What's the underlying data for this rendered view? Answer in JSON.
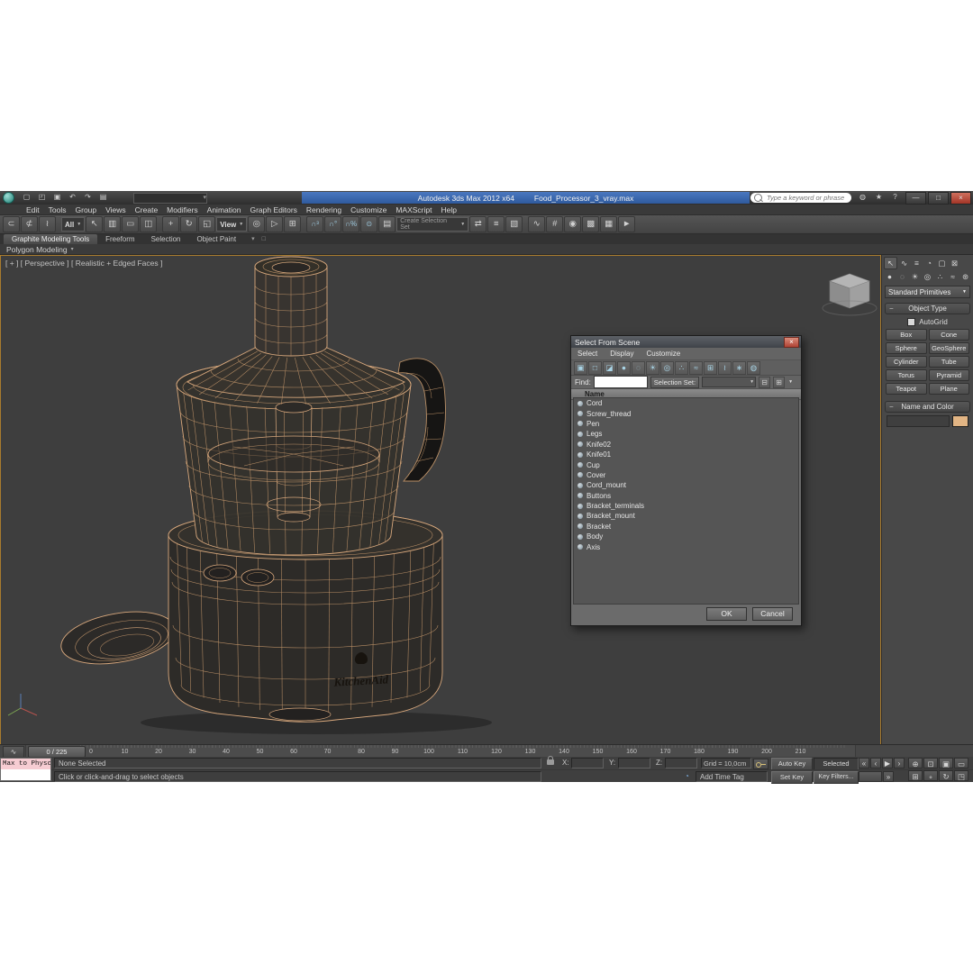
{
  "colors": {
    "wireframe": "#d8a87d",
    "wireframe_dim": "#b98f66",
    "viewport_border": "#a87b2e",
    "object_color": "#e2b584",
    "close_button": "#b04335",
    "title_strip": "#3f6db5"
  },
  "window": {
    "title_app": "Autodesk 3ds Max 2012 x64",
    "title_file": "Food_Processor_3_vray.max",
    "search_placeholder": "Type a keyword or phrase"
  },
  "icons": {
    "new": "▢",
    "open": "◰",
    "save": "▣",
    "undo": "↶",
    "redo": "↷",
    "project": "▤",
    "caret": "▼",
    "caret_small": "▾",
    "minimize": "—",
    "maximize": "□",
    "close": "×",
    "comm": "◍",
    "fav": "★",
    "help": "?",
    "link": "⊂",
    "unlink": "⊄",
    "bind": "≀",
    "sel": "↖",
    "byname": "▥",
    "region": "▭",
    "window": "◫",
    "move": "+",
    "rotate": "↻",
    "scale": "◱",
    "pivot": "◎",
    "manip": "▷",
    "kbd": "⊞",
    "snap": "∩³",
    "asnap": "∩°",
    "psnap": "∩%",
    "ssnap": "⊙",
    "sets": "▤",
    "mirror": "⇄",
    "align": "≡",
    "layers": "▧",
    "curve": "∿",
    "schem": "#",
    "mat": "◉",
    "rset": "▩",
    "rfw": "▦",
    "render": "►",
    "create": "↖",
    "modify": "∿",
    "hier": "≡",
    "motion": "◔",
    "display": "▢",
    "utils": "⊠",
    "geo": "●",
    "shapes": "◌",
    "lights": "☀",
    "cams": "◎",
    "helpers": "∴",
    "warps": "≈",
    "systems": "⊛",
    "collapse": "−",
    "dlg_tools": [
      "▣",
      "□",
      "◪",
      "●",
      "◌",
      "☀",
      "◎",
      "∴",
      "≈",
      "⊞",
      "≀",
      "∗",
      "◍"
    ],
    "find_tools": [
      "⊟",
      "⊞"
    ],
    "play_start": "«",
    "play_prev": "‹",
    "play": "▶",
    "play_next": "›",
    "play_end": "»",
    "nav": [
      "⊕",
      "⊡",
      "▣",
      "▭",
      "⊞",
      "∘",
      "↻",
      "◳"
    ],
    "timetag": "◔"
  },
  "menus": [
    "Edit",
    "Tools",
    "Group",
    "Views",
    "Create",
    "Modifiers",
    "Animation",
    "Graph Editors",
    "Rendering",
    "Customize",
    "MAXScript",
    "Help"
  ],
  "toolbar": {
    "filter": "All",
    "coord": "View",
    "named_set": "Create Selection Set"
  },
  "ribbon": {
    "tabs": [
      "Graphite Modeling Tools",
      "Freeform",
      "Selection",
      "Object Paint"
    ],
    "panel": "Polygon Modeling"
  },
  "viewport": {
    "label": "[ + ] [ Perspective ] [ Realistic + Edged Faces ]",
    "brand": "KitchenAid"
  },
  "command_panel": {
    "dropdown": "Standard Primitives",
    "object_type": "Object Type",
    "autogrid": "AutoGrid",
    "buttons": [
      "Box",
      "Cone",
      "Sphere",
      "GeoSphere",
      "Cylinder",
      "Tube",
      "Torus",
      "Pyramid",
      "Teapot",
      "Plane"
    ],
    "name_color": "Name and Color"
  },
  "dialog": {
    "title": "Select From Scene",
    "menus": [
      "Select",
      "Display",
      "Customize"
    ],
    "find": "Find:",
    "selection_set": "Selection Set:",
    "column": "Name",
    "items": [
      "Cord",
      "Screw_thread",
      "Pen",
      "Legs",
      "Knife02",
      "Knife01",
      "Cup",
      "Cover",
      "Cord_mount",
      "Buttons",
      "Bracket_terminals",
      "Bracket_mount",
      "Bracket",
      "Body",
      "Axis"
    ],
    "ok": "OK",
    "cancel": "Cancel"
  },
  "timeline": {
    "slider": "0 / 225",
    "ticks": [
      "0",
      "10",
      "20",
      "30",
      "40",
      "50",
      "60",
      "70",
      "80",
      "90",
      "100",
      "110",
      "120",
      "130",
      "140",
      "150",
      "160",
      "170",
      "180",
      "190",
      "200",
      "210"
    ]
  },
  "status": {
    "selection": "None Selected",
    "prompt": "Click or click-and-drag to select objects",
    "x": "X:",
    "y": "Y:",
    "z": "Z:",
    "grid": "Grid = 10,0cm",
    "auto_key": "Auto Key",
    "set_key": "Set Key",
    "selected": "Selected",
    "key_filters": "Key Filters...",
    "add_time_tag": "Add Time Tag",
    "listener": "Max to Physc."
  }
}
